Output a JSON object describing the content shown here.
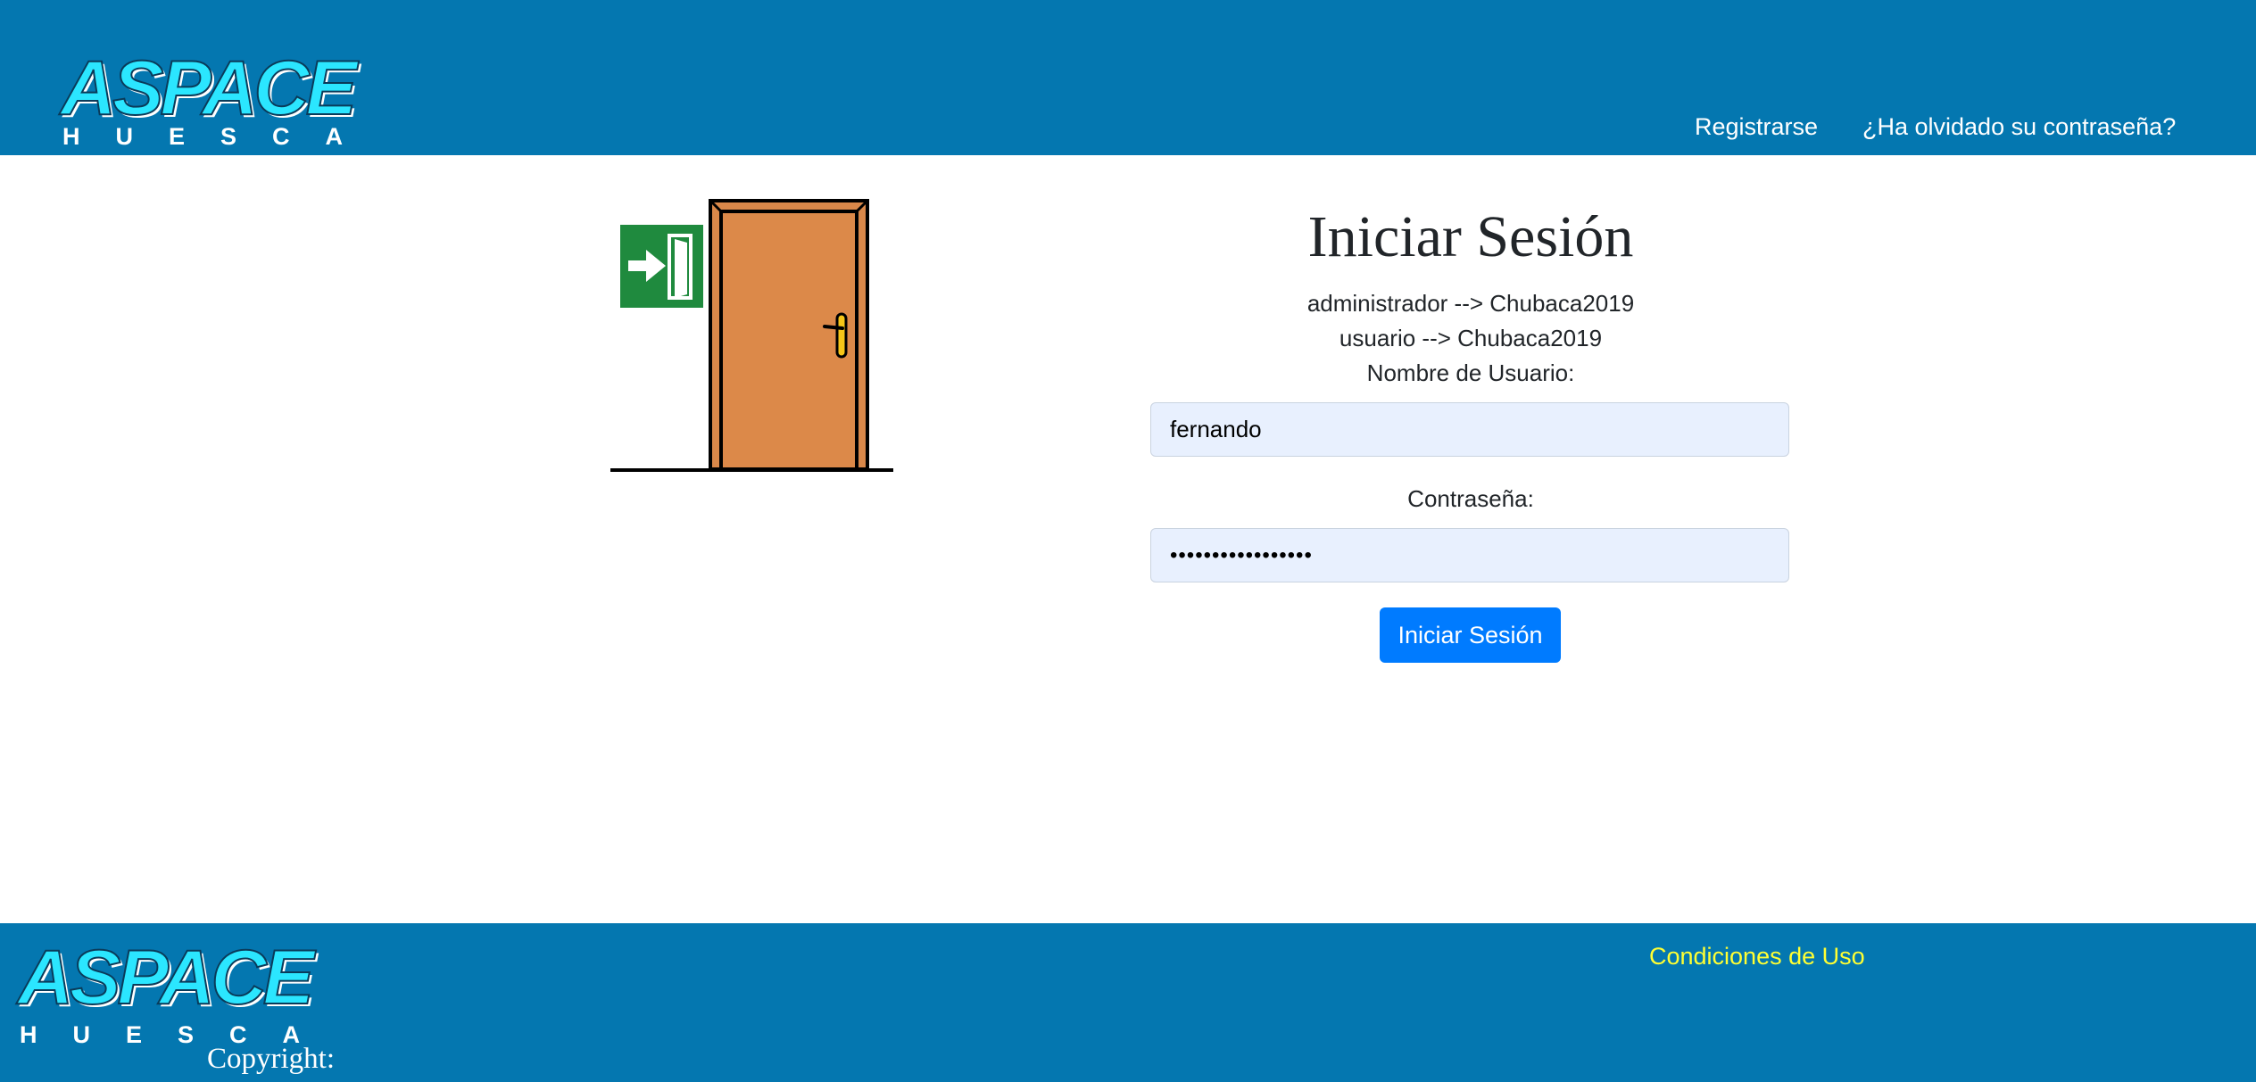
{
  "header": {
    "logo": {
      "main": "ASPACE",
      "sub": "HUESCA"
    },
    "nav": {
      "register": "Registrarse",
      "forgot_password": "¿Ha olvidado su contraseña?"
    }
  },
  "illustration": {
    "icon": "exit-door-icon",
    "sign_icon": "emergency-exit-sign-icon"
  },
  "login": {
    "title": "Iniciar Sesión",
    "hint_admin": "administrador --> Chubaca2019",
    "hint_user": "usuario --> Chubaca2019",
    "username_label": "Nombre de Usuario:",
    "username_value": "fernando",
    "password_label": "Contraseña:",
    "password_value": "•••••••••••••••••",
    "submit_label": "Iniciar Sesión"
  },
  "footer": {
    "logo": {
      "main": "ASPACE",
      "sub": "HUESCA"
    },
    "conditions": "Condiciones de Uso",
    "copyright": "Copyright:"
  },
  "colors": {
    "header_bg": "#0477b0",
    "input_bg": "#e8f0fe",
    "button_bg": "#007bff",
    "footer_link": "#ffff33",
    "logo_accent": "#2be6ff"
  }
}
